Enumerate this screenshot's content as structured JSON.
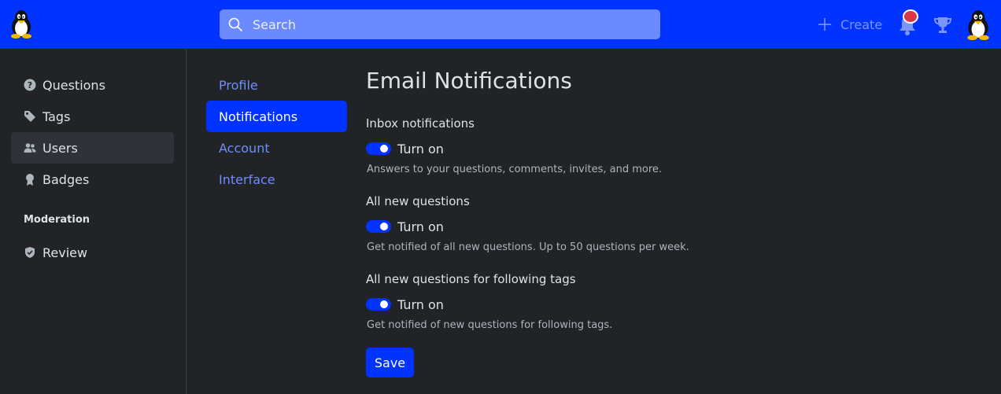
{
  "header": {
    "search_placeholder": "Search",
    "create_label": "Create"
  },
  "sidebar": {
    "items": [
      {
        "label": "Questions",
        "icon": "question-circle-icon"
      },
      {
        "label": "Tags",
        "icon": "tag-icon"
      },
      {
        "label": "Users",
        "icon": "people-icon",
        "active": true
      },
      {
        "label": "Badges",
        "icon": "award-icon"
      }
    ],
    "moderation_title": "Moderation",
    "review_label": "Review"
  },
  "settings_nav": {
    "items": [
      {
        "label": "Profile"
      },
      {
        "label": "Notifications",
        "active": true
      },
      {
        "label": "Account"
      },
      {
        "label": "Interface"
      }
    ]
  },
  "main": {
    "title": "Email Notifications",
    "sections": [
      {
        "label": "Inbox notifications",
        "toggle_label": "Turn on",
        "enabled": true,
        "help": "Answers to your questions, comments, invites, and more."
      },
      {
        "label": "All new questions",
        "toggle_label": "Turn on",
        "enabled": true,
        "help": "Get notified of all new questions. Up to 50 questions per week."
      },
      {
        "label": "All new questions for following tags",
        "toggle_label": "Turn on",
        "enabled": true,
        "help": "Get notified of new questions for following tags."
      }
    ],
    "save_label": "Save"
  },
  "colors": {
    "brand": "#0033ff",
    "background": "#212327",
    "link": "#6e8efb",
    "notification_dot": "#dc3545"
  }
}
